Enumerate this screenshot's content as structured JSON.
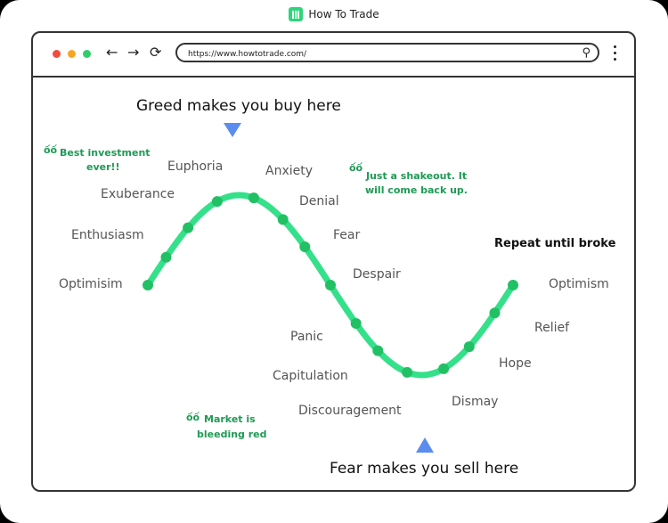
{
  "brand": {
    "name": "How To Trade"
  },
  "browser": {
    "url": "https://www.howtotrade.com/",
    "dots": [
      "#f24b3d",
      "#f6a623",
      "#2fce6a"
    ],
    "back": "←",
    "forward": "→",
    "reload": "⟳",
    "search": "⚲"
  },
  "diagram": {
    "greed": "Greed makes you buy here",
    "fear": "Fear makes you sell here",
    "repeat": "Repeat until broke",
    "quote_mark": "ốố",
    "quotes": [
      "Best investment",
      "ever!!",
      "Just a shakeout. It",
      "will come back up.",
      "Market is",
      "bleeding red"
    ],
    "stages": [
      "Optimisim",
      "Enthusiasm",
      "Exuberance",
      "Euphoria",
      "Anxiety",
      "Denial",
      "Fear",
      "Despair",
      "Panic",
      "Capitulation",
      "Discouragement",
      "Dismay",
      "Hope",
      "Relief",
      "Optimism"
    ],
    "colors": {
      "curve": "#35e08a",
      "point": "#22c064",
      "arrow": "#5b8def",
      "quote": "#1f9a55"
    }
  }
}
